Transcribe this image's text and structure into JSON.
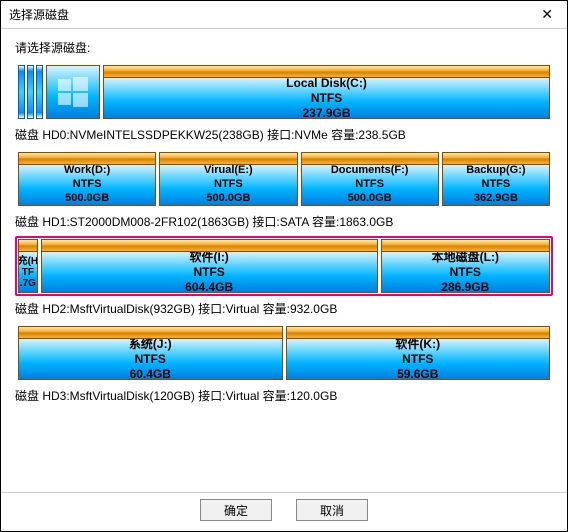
{
  "window": {
    "title": "选择源磁盘"
  },
  "prompt": "请选择源磁盘:",
  "disks": [
    {
      "caption": "磁盘 HD0:NVMeINTELSSDPEKKW25(238GB)  接口:NVMe  容量:238.5GB",
      "stripes": 3,
      "winIcon": true,
      "selected": false,
      "partitions": [
        {
          "name": "Local Disk(C:)",
          "fs": "NTFS",
          "size": "237.9GB",
          "flex": 1
        }
      ]
    },
    {
      "caption": "磁盘 HD1:ST2000DM008-2FR102(1863GB)  接口:SATA  容量:1863.0GB",
      "stripes": 0,
      "winIcon": false,
      "selected": false,
      "partitions": [
        {
          "name": "Work(D:)",
          "fs": "NTFS",
          "size": "500.0GB",
          "flex": 1
        },
        {
          "name": "Virual(E:)",
          "fs": "NTFS",
          "size": "500.0GB",
          "flex": 1
        },
        {
          "name": "Documents(F:)",
          "fs": "NTFS",
          "size": "500.0GB",
          "flex": 1
        },
        {
          "name": "Backup(G:)",
          "fs": "NTFS",
          "size": "362.9GB",
          "flex": 0.78
        }
      ]
    },
    {
      "caption": "磁盘 HD2:MsftVirtualDisk(932GB)  接口:Virtual  容量:932.0GB",
      "stripes": 0,
      "winIcon": false,
      "selected": true,
      "partitions": [
        {
          "name": "充(H",
          "fs": "TF",
          "size": ".7G",
          "flex": 0.09,
          "tiny": true
        },
        {
          "name": "软件(I:)",
          "fs": "NTFS",
          "size": "604.4GB",
          "flex": 1.7
        },
        {
          "name": "本地磁盘(L:)",
          "fs": "NTFS",
          "size": "286.9GB",
          "flex": 0.85
        }
      ]
    },
    {
      "caption": "磁盘 HD3:MsftVirtualDisk(120GB)  接口:Virtual  容量:120.0GB",
      "stripes": 0,
      "winIcon": false,
      "selected": false,
      "partitions": [
        {
          "name": "系统(J:)",
          "fs": "NTFS",
          "size": "60.4GB",
          "flex": 1
        },
        {
          "name": "软件(K:)",
          "fs": "NTFS",
          "size": "59.6GB",
          "flex": 1
        }
      ]
    }
  ],
  "buttons": {
    "ok": "确定",
    "cancel": "取消"
  }
}
